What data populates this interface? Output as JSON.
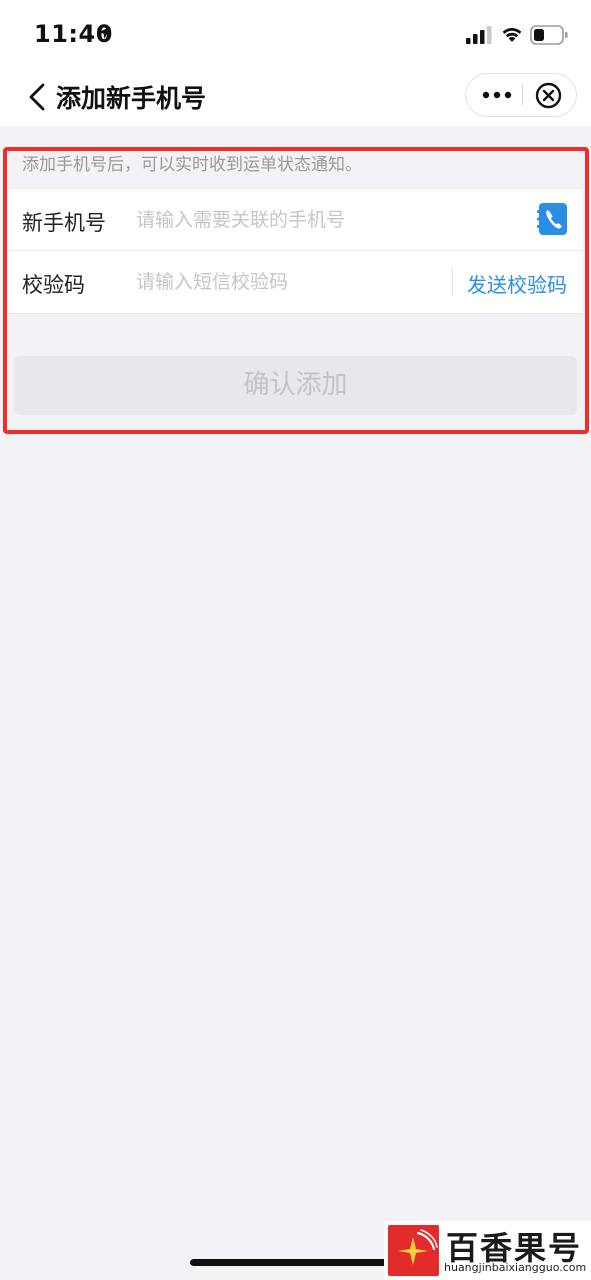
{
  "status_bar": {
    "time": "11:40",
    "location_icon": "location-arrow-icon",
    "signal_icon": "cellular-signal-icon",
    "wifi_icon": "wifi-icon",
    "battery_icon": "battery-icon"
  },
  "nav": {
    "title": "添加新手机号",
    "back_icon": "chevron-left-icon",
    "more_icon": "more-dots-icon",
    "close_icon": "close-circle-icon"
  },
  "tip": "添加手机号后，可以实时收到运单状态通知。",
  "form": {
    "phone": {
      "label": "新手机号",
      "value": "",
      "placeholder": "请输入需要关联的手机号",
      "icon": "contacts-phone-icon"
    },
    "code": {
      "label": "校验码",
      "value": "",
      "placeholder": "请输入短信校验码",
      "send_label": "发送校验码"
    }
  },
  "confirm_button": "确认添加",
  "watermark": {
    "title": "百香果号",
    "url": "huangjinbaixiangguo.com"
  },
  "colors": {
    "accent": "#2a8ee6",
    "highlight": "#f22b2b",
    "background": "#f3f2f7",
    "button_disabled": "#e8e7ec"
  }
}
